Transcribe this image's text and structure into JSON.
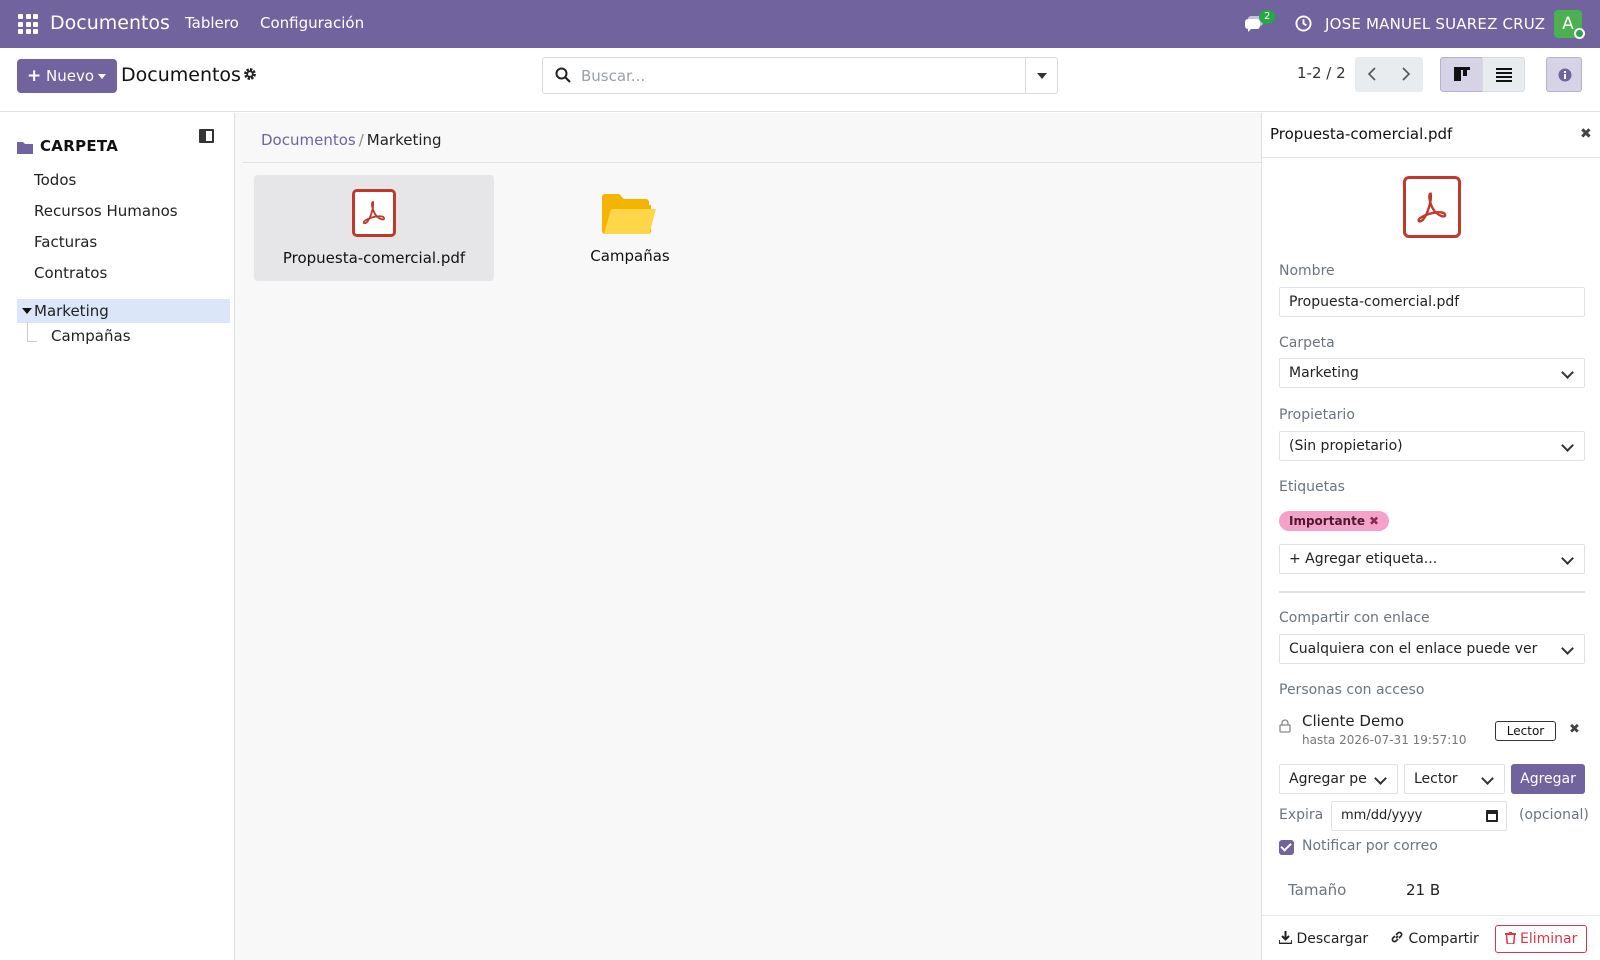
{
  "navbar": {
    "brand": "Documentos",
    "menu": [
      "Tablero",
      "Configuración"
    ],
    "chat_count": "2",
    "user_name": "JOSE MANUEL SUAREZ CRUZ",
    "avatar_letter": "A"
  },
  "control": {
    "new_label": "Nuevo",
    "title": "Documentos",
    "search_placeholder": "Buscar...",
    "pager": "1-2 / 2"
  },
  "sidebar": {
    "title": "CARPETA",
    "items": [
      "Todos",
      "Recursos Humanos",
      "Facturas",
      "Contratos",
      "Marketing"
    ],
    "active_item": "Marketing",
    "sub_items": [
      "Campañas"
    ]
  },
  "main": {
    "breadcrumb": [
      "Documentos",
      "Marketing"
    ],
    "cards": [
      {
        "name": "Propuesta-comercial.pdf",
        "icon": "pdf-icon"
      },
      {
        "name": "Campañas",
        "icon": "folder-icon"
      }
    ]
  },
  "panel": {
    "title": "Propuesta-comercial.pdf",
    "name_label": "Nombre",
    "name_value": "Propuesta-comercial.pdf",
    "folder_label": "Carpeta",
    "folder_value": "Marketing",
    "owner_label": "Propietario",
    "owner_value": "(Sin propietario)",
    "tags_label": "Etiquetas",
    "tag": "Importante",
    "add_tag": "+ Agregar etiqueta...",
    "share_label": "Compartir con enlace",
    "share_value": "Cualquiera con el enlace puede ver",
    "people_label": "Personas con acceso",
    "person_name": "Cliente Demo",
    "person_until": "hasta 2026-07-31 19:57:10",
    "person_role": "Lector",
    "add_person": "Agregar pe",
    "add_role": "Lector",
    "add_button": "Agregar",
    "expires_label": "Expira",
    "date_placeholder": "mm/dd/yyyy",
    "optional": "(opcional)",
    "notify_label": "Notificar por correo",
    "size_label": "Tamaño",
    "size_value": "21 B",
    "download": "Descargar",
    "share": "Compartir",
    "delete": "Eliminar"
  },
  "colors": {
    "brand": "#71639e",
    "pdf": "#c0392b",
    "folder": "#f5b400",
    "tag": "#f4a2c9",
    "danger": "#dc3545"
  }
}
